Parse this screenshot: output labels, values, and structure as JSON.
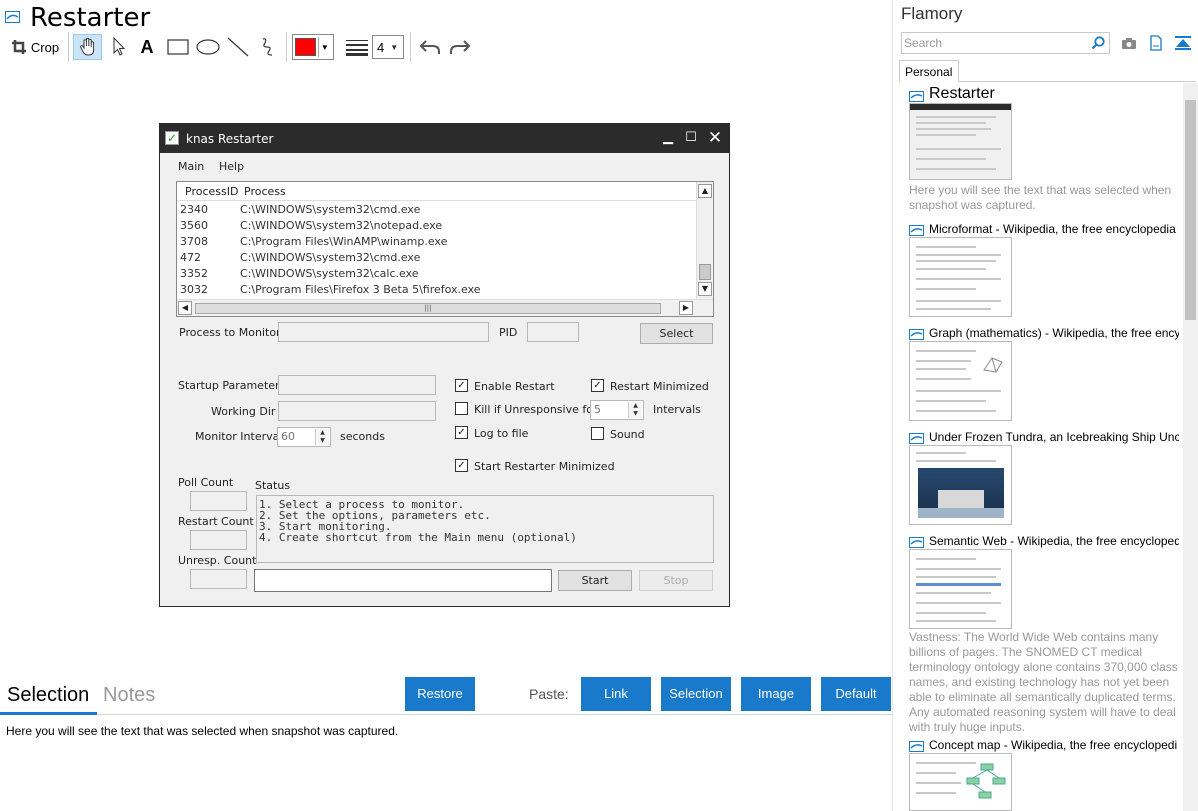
{
  "header": {
    "title": "Restarter"
  },
  "toolbar": {
    "crop_label": "Crop",
    "text_tool_glyph": "A",
    "line_width_value": "4",
    "color": "#ff0000",
    "icons": [
      "crop-icon",
      "hand-icon",
      "pointer-icon",
      "text-icon",
      "rectangle-icon",
      "ellipse-icon",
      "line-icon",
      "freehand-icon",
      "line-width-icon",
      "undo-icon",
      "redo-icon"
    ]
  },
  "shot": {
    "window_title": "knas Restarter",
    "menu": [
      "Main",
      "Help"
    ],
    "columns": [
      "ProcessID",
      "Process"
    ],
    "processes": [
      {
        "pid": "2340",
        "name": "C:\\WINDOWS\\system32\\cmd.exe"
      },
      {
        "pid": "3560",
        "name": "C:\\WINDOWS\\system32\\notepad.exe"
      },
      {
        "pid": "3708",
        "name": "C:\\Program Files\\WinAMP\\winamp.exe"
      },
      {
        "pid": "472",
        "name": "C:\\WINDOWS\\system32\\cmd.exe"
      },
      {
        "pid": "3352",
        "name": "C:\\WINDOWS\\system32\\calc.exe"
      },
      {
        "pid": "3032",
        "name": "C:\\Program Files\\Firefox 3 Beta 5\\firefox.exe"
      }
    ],
    "process_to_monitor_label": "Process to Monitor",
    "pid_label": "PID",
    "select_label": "Select",
    "startup_params_label": "Startup Parameters",
    "working_dir_label": "Working Dir",
    "monitor_interval_label": "Monitor Interval",
    "monitor_interval_value": "60",
    "seconds_label": "seconds",
    "enable_restart_label": "Enable Restart",
    "kill_label": "Kill if Unresponsive for:",
    "kill_value": "5",
    "intervals_label": "Intervals",
    "log_label": "Log to file",
    "restart_min_label": "Restart Minimized",
    "sound_label": "Sound",
    "start_min_label": "Start Restarter Minimized",
    "poll_count_label": "Poll Count",
    "restart_count_label": "Restart Count",
    "unresp_count_label": "Unresp. Count",
    "status_label": "Status",
    "status_lines": [
      "1. Select a process to monitor.",
      "2. Set the options, parameters etc.",
      "3. Start monitoring.",
      "4. Create shortcut from the Main menu (optional)"
    ],
    "start_label": "Start",
    "stop_label": "Stop",
    "checks": {
      "enable_restart": true,
      "kill": false,
      "log": true,
      "restart_min": true,
      "sound": false,
      "start_min": true
    }
  },
  "bottom": {
    "tab_selection": "Selection",
    "tab_notes": "Notes",
    "restore_label": "Restore",
    "paste_label": "Paste:",
    "link_label": "Link",
    "selection_label": "Selection",
    "image_label": "Image",
    "default_label": "Default",
    "selection_text": "Here you will see the text that was selected when snapshot was captured.",
    "accent": "#1979ca"
  },
  "right": {
    "title": "Flamory",
    "search_placeholder": "Search",
    "tab_personal": "Personal",
    "snapshots": [
      {
        "title": "Restarter",
        "desc": "Here you will see the text that was selected when snapshot was captured."
      },
      {
        "title": "Microformat - Wikipedia, the free encyclopedia",
        "desc": ""
      },
      {
        "title": "Graph (mathematics) - Wikipedia, the free ency",
        "desc": ""
      },
      {
        "title": "Under Frozen Tundra, an Icebreaking Ship Unco",
        "desc": ""
      },
      {
        "title": "Semantic Web - Wikipedia, the free encycloped",
        "desc": "Vastness: The World Wide Web contains many billions of pages. The SNOMED CT medical terminology ontology alone contains 370,000 class names, and existing technology has not yet been able to eliminate all semantically duplicated terms. Any automated reasoning system will have to deal with truly huge inputs."
      },
      {
        "title": "Concept map - Wikipedia, the free encyclopedi",
        "desc": ""
      }
    ]
  }
}
